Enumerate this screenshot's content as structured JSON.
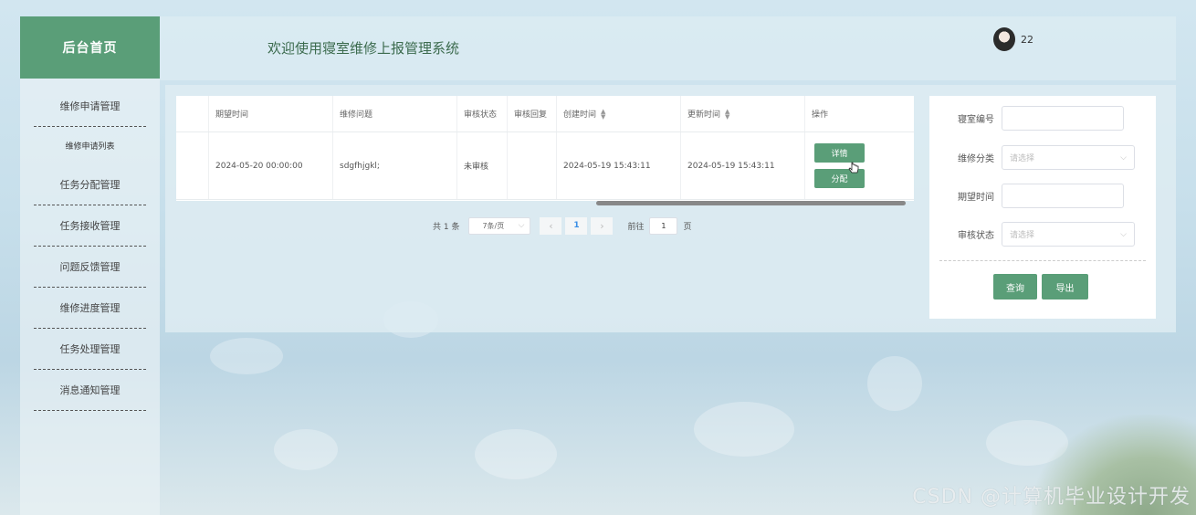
{
  "sidebar": {
    "home_label": "后台首页",
    "items": [
      {
        "label": "维修申请管理"
      },
      {
        "label": "任务分配管理"
      },
      {
        "label": "任务接收管理"
      },
      {
        "label": "问题反馈管理"
      },
      {
        "label": "维修进度管理"
      },
      {
        "label": "任务处理管理"
      },
      {
        "label": "消息通知管理"
      }
    ],
    "sub_item": "维修申请列表"
  },
  "header": {
    "title": "欢迎使用寝室维修上报管理系统",
    "user_name": "22",
    "avatar_icon": "user-avatar"
  },
  "table": {
    "columns": [
      "期望时间",
      "维修问题",
      "审核状态",
      "审核回复",
      "创建时间",
      "更新时间",
      "操作"
    ],
    "rows": [
      {
        "expected_time": "2024-05-20 00:00:00",
        "problem": "sdgfhjgkl;",
        "review_status": "未审核",
        "review_reply": "",
        "created_time": "2024-05-19 15:43:11",
        "updated_time": "2024-05-19 15:43:11",
        "detail_label": "详情",
        "assign_label": "分配"
      }
    ]
  },
  "pagination": {
    "total": "共 1 条",
    "page_size": "7条/页",
    "current_page": "1",
    "goto_label": "前往",
    "goto_value": "1",
    "page_unit": "页"
  },
  "search": {
    "room_label": "寝室编号",
    "category_label": "维修分类",
    "category_placeholder": "请选择",
    "expected_label": "期望时间",
    "status_label": "审核状态",
    "status_placeholder": "请选择",
    "query_label": "查询",
    "export_label": "导出"
  },
  "watermark": "CSDN @计算机毕业设计开发",
  "colors": {
    "accent": "#5a9e78",
    "pager_active": "#3a8ee6"
  }
}
